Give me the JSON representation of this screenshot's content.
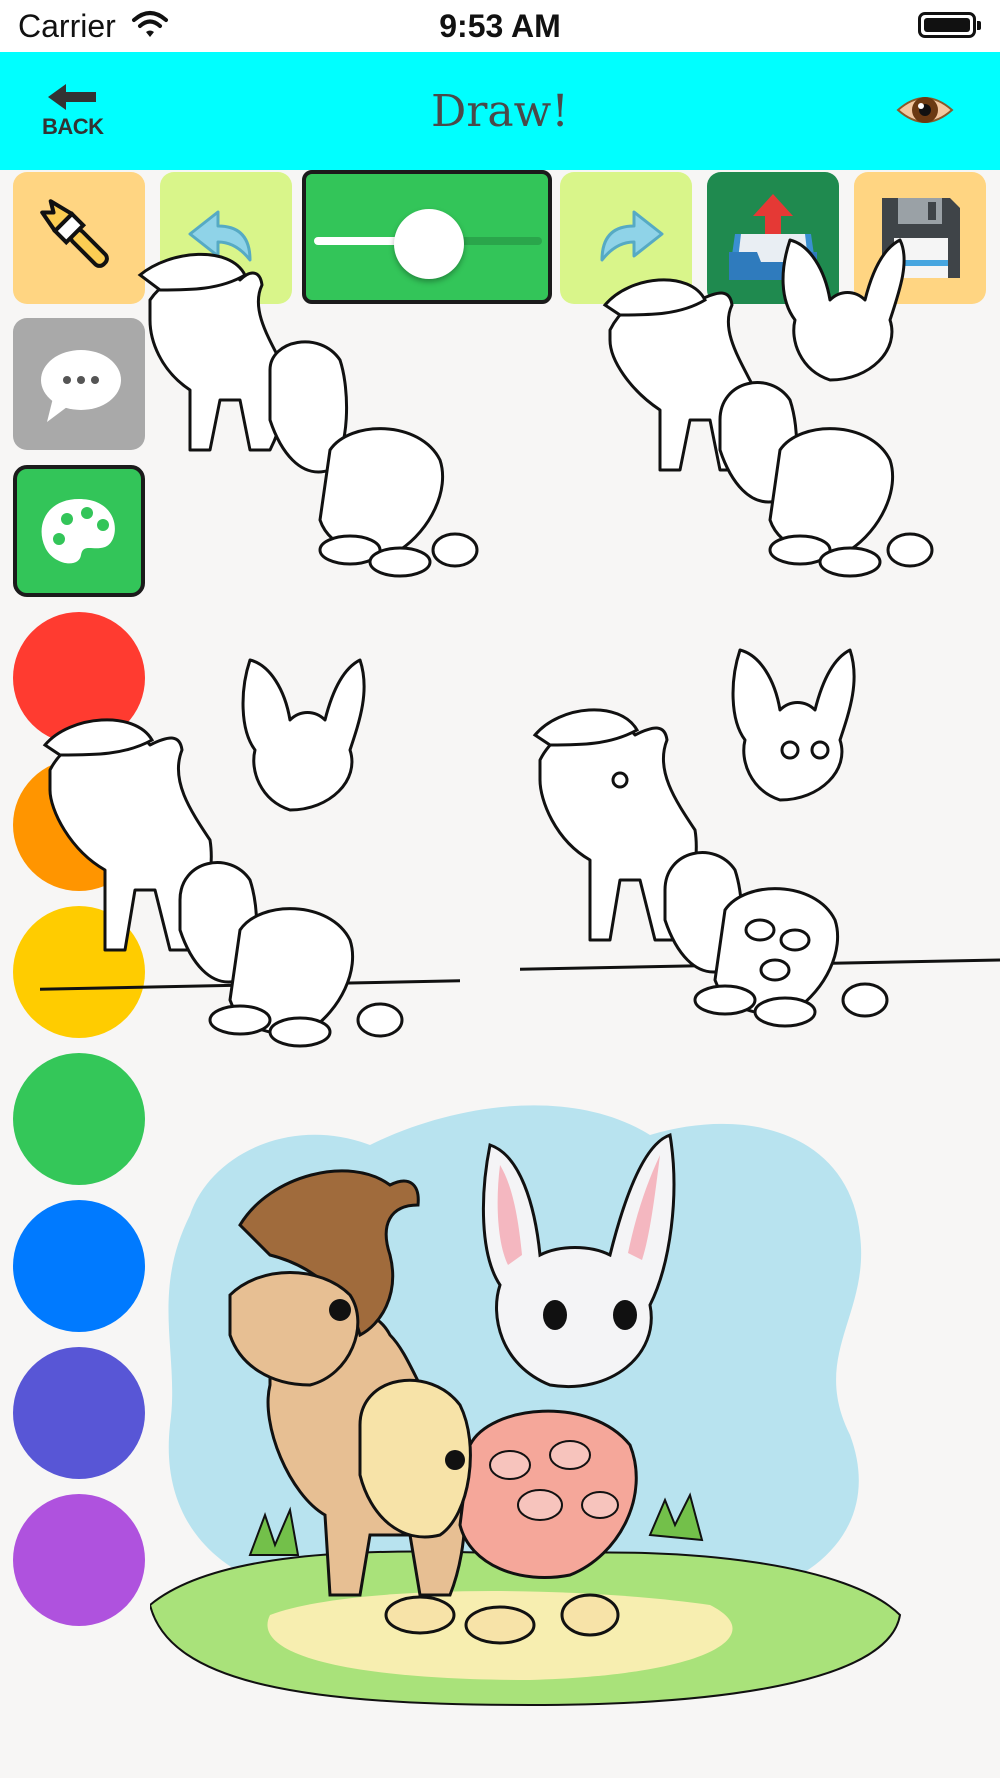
{
  "status_bar": {
    "carrier": "Carrier",
    "time": "9:53 AM"
  },
  "nav": {
    "back_label": "BACK",
    "title": "Draw!",
    "icons": [
      "back-arrow-icon",
      "eye-icon"
    ]
  },
  "toolbar": {
    "tools": [
      "brush-icon",
      "undo-icon",
      "size-slider",
      "redo-icon",
      "share-upload-icon",
      "floppy-save-icon",
      "speech-bubble-icon",
      "palette-icon"
    ],
    "brush_size_fraction": 0.42
  },
  "palette": {
    "colors": [
      "#ff3b30",
      "#ff9500",
      "#ffcc00",
      "#34c759",
      "#007aff",
      "#5856d6",
      "#af52de"
    ]
  },
  "colors": {
    "nav_bg": "#00ffff",
    "tool_yellow": "#ffd582",
    "tool_lime": "#d9f58a",
    "tool_green": "#33c559",
    "tool_dark_green": "#1f8a4f",
    "tool_gray": "#a9a9a9",
    "canvas_bg": "#f7f6f5"
  },
  "drawing_steps": [
    "step-1-outline",
    "step-2-outline",
    "step-3-outline",
    "step-4-outline",
    "step-5-colored"
  ]
}
